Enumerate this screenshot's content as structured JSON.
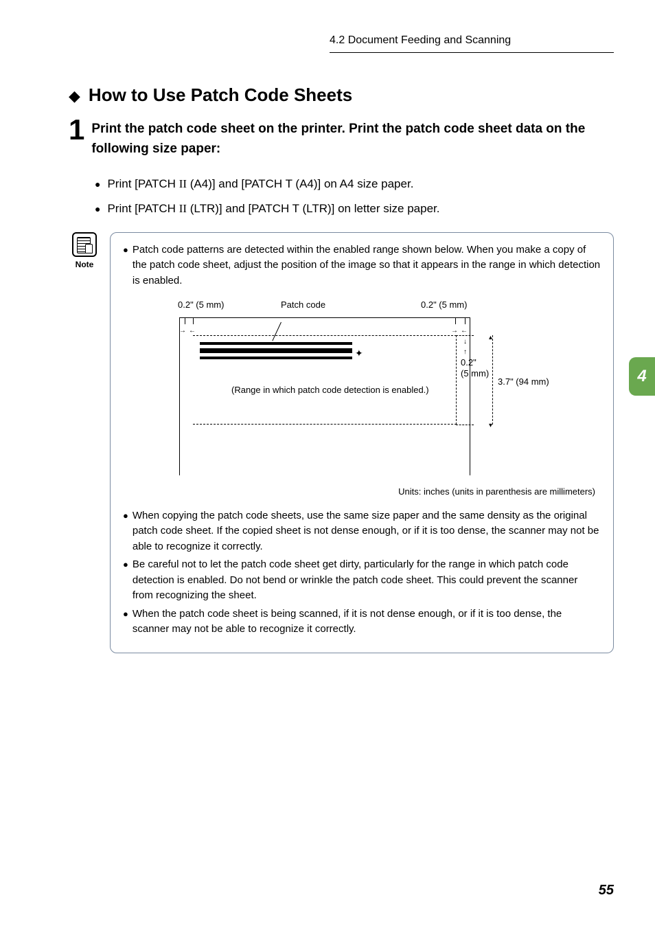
{
  "header": {
    "section": "4.2   Document Feeding and Scanning"
  },
  "title": {
    "diamond": "◆",
    "text": "How to Use Patch Code Sheets"
  },
  "step1": {
    "number": "1",
    "text": "Print the patch code sheet on the printer. Print the patch code sheet data on the following size paper:"
  },
  "bullets": [
    {
      "pre": "Print [PATCH ",
      "roman": "II",
      "post": " (A4)] and [PATCH T (A4)] on A4 size paper."
    },
    {
      "pre": "Print [PATCH ",
      "roman": "II",
      "post": " (LTR)] and [PATCH T (LTR)] on letter size paper."
    }
  ],
  "note": {
    "label": "Note",
    "items": [
      "Patch code patterns are detected within the enabled range shown below. When you make a copy of the patch code sheet, adjust the position of the image so that it appears in the range in which detection is enabled.",
      "When copying the patch code sheets, use the same size paper and the same density as the original patch code sheet. If the copied sheet is not dense enough, or if it is too dense, the scanner may not be able to recognize it correctly.",
      "Be careful not to let the patch code sheet get dirty, particularly for the range in which patch code detection is enabled. Do not bend or wrinkle the patch code sheet. This could prevent the scanner from recognizing the sheet.",
      "When the patch code sheet is being scanned, if it is not dense enough, or if it is too dense, the scanner may not be able to recognize it correctly."
    ],
    "diagram": {
      "left_margin": "0.2\" (5 mm)",
      "right_margin": "0.2\" (5 mm)",
      "top_offset": "0.2\"\n(5 mm)",
      "height": "3.7\" (94 mm)",
      "patch_label": "Patch code",
      "range_label": "(Range in which patch code detection is enabled.)",
      "units": "Units: inches (units in parenthesis are millimeters)"
    }
  },
  "chapter_tab": "4",
  "page_number": "55"
}
